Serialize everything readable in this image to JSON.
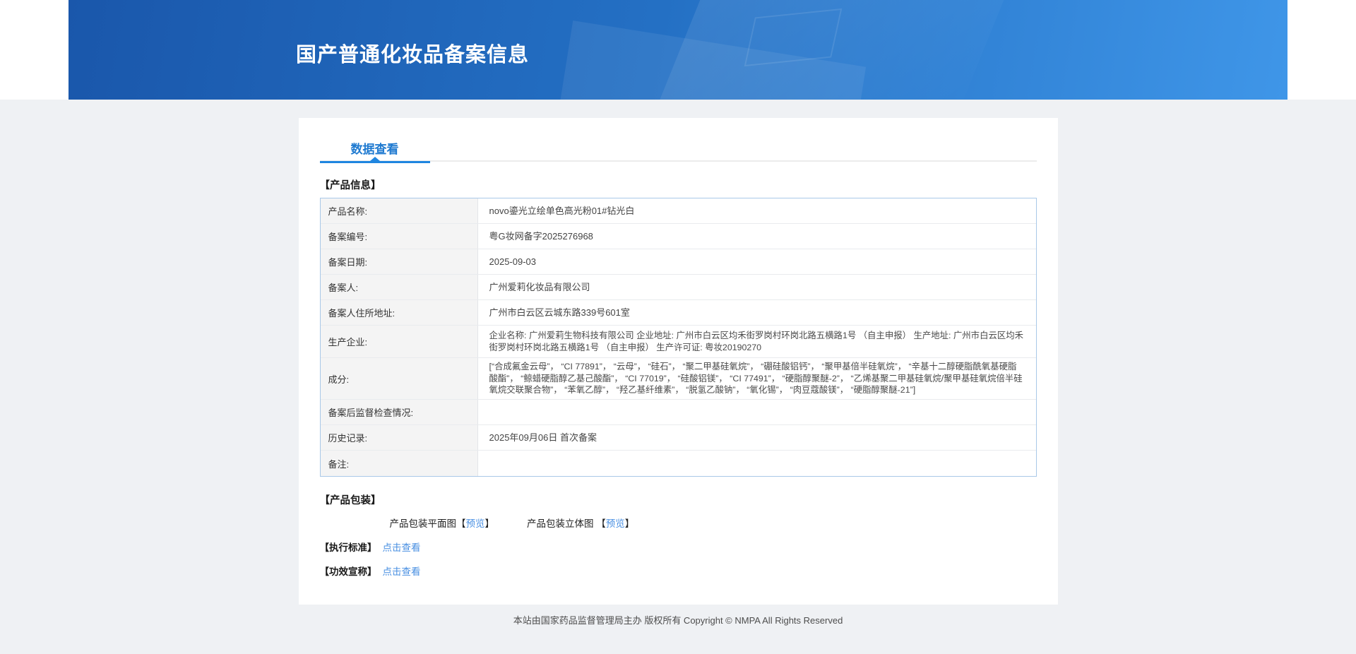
{
  "page": {
    "title": "国产普通化妆品备案信息",
    "footer": "本站由国家药品监督管理局主办 版权所有 Copyright © NMPA All Rights Reserved"
  },
  "tabs": {
    "data_view": "数据查看"
  },
  "sections": {
    "product_info": "【产品信息】",
    "packaging": "【产品包装】",
    "standard": "【执行标准】",
    "efficacy": "【功效宣称】"
  },
  "product_table": {
    "rows": [
      {
        "label": "产品名称:",
        "value": "novo鎏光立绘单色高光粉01#钻光白"
      },
      {
        "label": "备案编号:",
        "value": "粤G妆网备字2025276968"
      },
      {
        "label": "备案日期:",
        "value": "2025-09-03"
      },
      {
        "label": "备案人:",
        "value": "广州爱莉化妆品有限公司"
      },
      {
        "label": "备案人住所地址:",
        "value": "广州市白云区云城东路339号601室"
      },
      {
        "label": "生产企业:",
        "value": "企业名称: 广州爱莉生物科技有限公司 企业地址: 广州市白云区均禾街罗岗村环岗北路五横路1号 （自主申报） 生产地址: 广州市白云区均禾街罗岗村环岗北路五横路1号 （自主申报） 生产许可证: 粤妆20190270"
      },
      {
        "label": "成分:",
        "value": "[“合成氟金云母”， “CI 77891”， “云母”， “硅石”， “聚二甲基硅氧烷”， “硼硅酸铝钙”， “聚甲基倍半硅氧烷”， “辛基十二醇硬脂酰氧基硬脂酸酯”， “鲸蜡硬脂醇乙基己酸酯”， “CI 77019”， “硅酸铝镁”， “CI 77491”， “硬脂醇聚醚-2”， “乙烯基聚二甲基硅氧烷/聚甲基硅氧烷倍半硅氧烷交联聚合物”， “苯氧乙醇”， “羟乙基纤维素”， “脱氢乙酸钠”， “氧化锡”， “肉豆蔻酸镁”， “硬脂醇聚醚-21”]"
      },
      {
        "label": "备案后监督检查情况:",
        "value": ""
      },
      {
        "label": "历史记录:",
        "value": "2025年09月06日 首次备案"
      },
      {
        "label": "备注:",
        "value": ""
      }
    ]
  },
  "packaging": {
    "flat_label": "产品包装平面图",
    "stereo_label": "产品包装立体图",
    "preview_label": "预览",
    "bracket_open": "【",
    "bracket_close": "】"
  },
  "links": {
    "view_label": "点击查看"
  },
  "colors": {
    "header_gradient_left": "#1a57ab",
    "header_gradient_right": "#3f96e8",
    "accent_blue": "#1f7ad0",
    "link_blue": "#4a90e2",
    "table_border": "#a9c8e8",
    "label_cell_bg": "#f4f4f4",
    "page_bg": "#eff1f4"
  }
}
